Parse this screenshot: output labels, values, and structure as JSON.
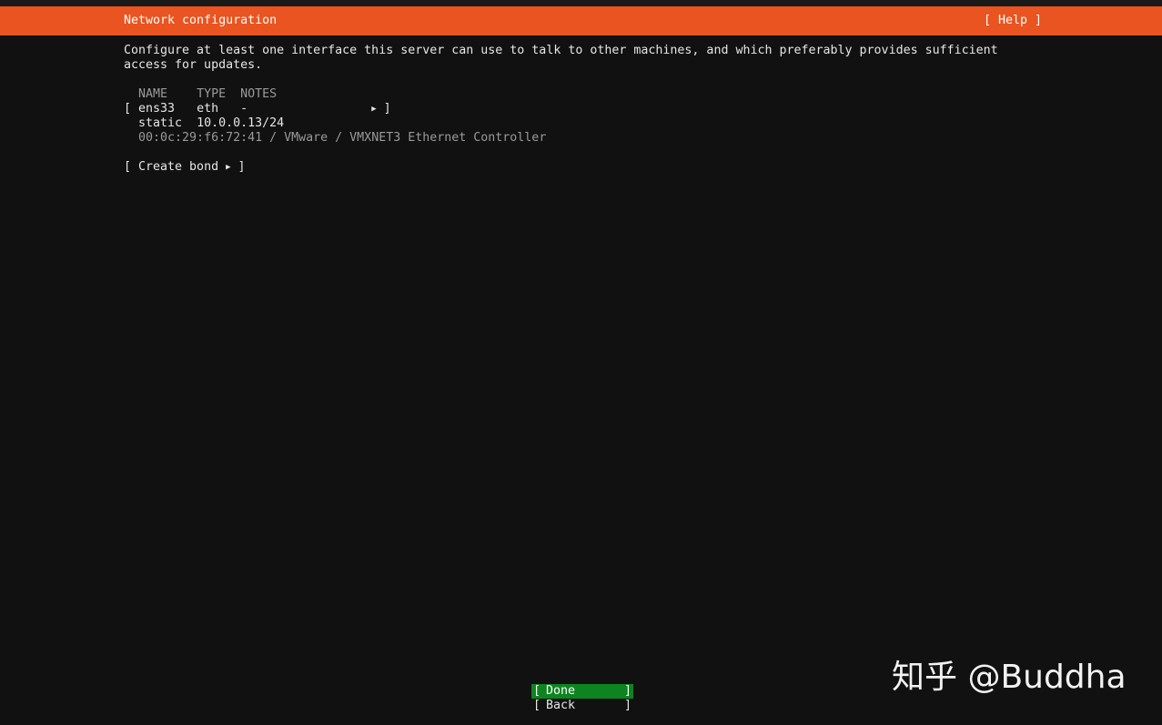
{
  "header": {
    "title": "Network configuration",
    "help_label": "[ Help ]"
  },
  "intro": {
    "line1": "Configure at least one interface this server can use to talk to other machines, and which preferably provides sufficient",
    "line2": "access for updates."
  },
  "table": {
    "headers": {
      "name": "NAME",
      "type": "TYPE",
      "notes": "NOTES"
    },
    "interfaces": [
      {
        "name": "ens33",
        "type": "eth",
        "notes": "-",
        "addr_method": "static",
        "address": "10.0.0.13/24",
        "hw_info": "00:0c:29:f6:72:41 / VMware / VMXNET3 Ethernet Controller"
      }
    ]
  },
  "actions": {
    "create_bond_label": "Create bond"
  },
  "buttons": {
    "done_label": "Done",
    "back_label": "Back"
  },
  "watermark": {
    "text": "知乎 @Buddha"
  },
  "colors": {
    "header_bg": "#e95420",
    "background": "#111111",
    "button_focus": "#0e8420"
  }
}
